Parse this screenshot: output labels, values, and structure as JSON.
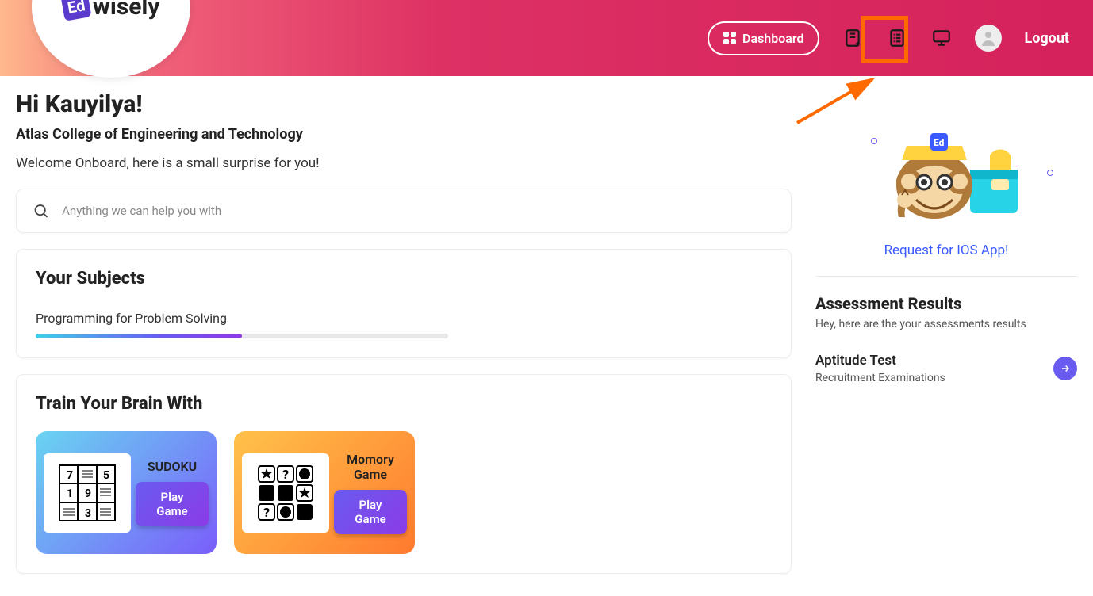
{
  "header": {
    "brand_prefix": "Ed",
    "brand_suffix": "wisely",
    "dashboard_label": "Dashboard",
    "logout_label": "Logout"
  },
  "greeting": {
    "hi": "Hi Kauyilya!",
    "college": "Atlas College of Engineering and Technology",
    "welcome": "Welcome Onboard, here is a small surprise for you!"
  },
  "search": {
    "placeholder": "Anything we can help you with"
  },
  "subjects": {
    "heading": "Your Subjects",
    "items": [
      {
        "name": "Programming for Problem Solving",
        "progress_pct": 50
      }
    ]
  },
  "games": {
    "heading": "Train Your Brain With",
    "play_label": "Play Game",
    "list": [
      {
        "title": "SUDOKU"
      },
      {
        "title": "Momory Game"
      }
    ]
  },
  "side": {
    "ios_link": "Request for IOS App!",
    "assessment_heading": "Assessment Results",
    "assessment_sub": "Hey, here are the your assessments results",
    "items": [
      {
        "title": "Aptitude Test",
        "subtitle": "Recruitment Examinations"
      }
    ]
  }
}
